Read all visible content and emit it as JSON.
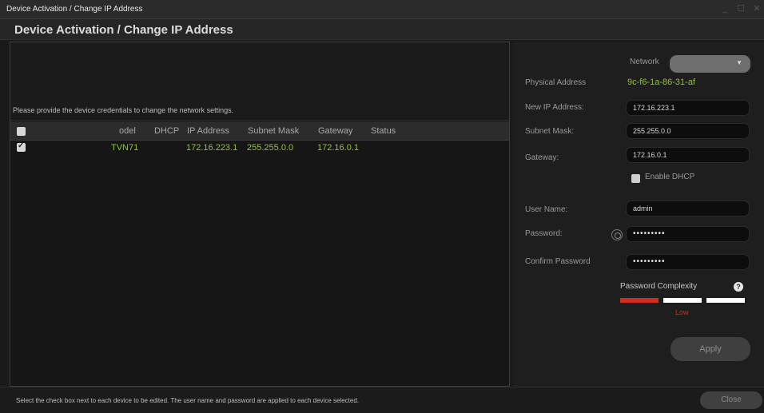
{
  "window": {
    "title": "Device Activation / Change IP Address",
    "minimize_glyph": "_",
    "maximize_glyph": "☐",
    "close_glyph": "✕"
  },
  "heading": "Device Activation / Change IP Address",
  "info_message": "Please provide the device credentials to change the network settings.",
  "grid": {
    "columns": [
      "odel",
      "DHCP",
      "IP Address",
      "Subnet Mask",
      "Gateway",
      "Status"
    ],
    "rows": [
      {
        "checked": true,
        "model": "TVN71",
        "dhcp": "",
        "ip_address": "172.16.223.1",
        "subnet_mask": "255.255.0.0",
        "gateway": "172.16.0.1",
        "status": ""
      }
    ]
  },
  "form": {
    "network_label": "Network",
    "network_value": "",
    "physical_address_label": "Physical Address",
    "physical_address_value": "9c-f6-1a-86-31-af",
    "new_ip_label": "New IP Address:",
    "new_ip_value": "172.16.223.1",
    "subnet_label": "Subnet Mask:",
    "subnet_value": "255.255.0.0",
    "gateway_label": "Gateway:",
    "gateway_value": "172.16.0.1",
    "enable_dhcp_label": "Enable DHCP",
    "enable_dhcp_checked": false,
    "username_label": "User Name:",
    "username_value": "admin",
    "password_label": "Password:",
    "password_value": "•••••••••",
    "confirm_password_label": "Confirm Password",
    "confirm_password_value": "•••••••••",
    "complexity_label": "Password Complexity",
    "complexity_level": "Low",
    "complexity_help": "?",
    "apply_label": "Apply"
  },
  "footer": {
    "note": "Select the check box next to each device to be edited. The user name and password are applied to each device selected.",
    "close_label": "Close"
  },
  "colors": {
    "accent_green": "#8fc23c",
    "complexity_low": "#d12b1f",
    "complexity_empty": "#ffffff"
  },
  "icons": {
    "eye": "eye-icon",
    "help": "help-icon",
    "dropdown": "chevron-down-icon"
  }
}
